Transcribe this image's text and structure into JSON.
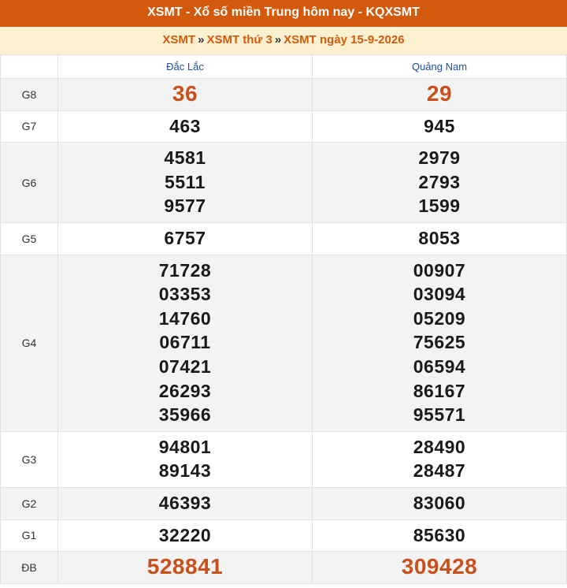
{
  "title": "XSMT - Xổ số miền Trung hôm nay - KQXSMT",
  "breadcrumb": {
    "items": [
      "XSMT",
      "XSMT thứ 3",
      "XSMT ngày 15-9-2026"
    ],
    "separator": "»"
  },
  "table": {
    "provinces": [
      "Đắc Lắc",
      "Quảng Nam"
    ],
    "prizes": [
      {
        "label": "G8",
        "values": [
          [
            "36"
          ],
          [
            "29"
          ]
        ],
        "highlight": true
      },
      {
        "label": "G7",
        "values": [
          [
            "463"
          ],
          [
            "945"
          ]
        ]
      },
      {
        "label": "G6",
        "values": [
          [
            "4581",
            "5511",
            "9577"
          ],
          [
            "2979",
            "2793",
            "1599"
          ]
        ]
      },
      {
        "label": "G5",
        "values": [
          [
            "6757"
          ],
          [
            "8053"
          ]
        ]
      },
      {
        "label": "G4",
        "values": [
          [
            "71728",
            "03353",
            "14760",
            "06711",
            "07421",
            "26293",
            "35966"
          ],
          [
            "00907",
            "03094",
            "05209",
            "75625",
            "06594",
            "86167",
            "95571"
          ]
        ]
      },
      {
        "label": "G3",
        "values": [
          [
            "94801",
            "89143"
          ],
          [
            "28490",
            "28487"
          ]
        ]
      },
      {
        "label": "G2",
        "values": [
          [
            "46393"
          ],
          [
            "83060"
          ]
        ]
      },
      {
        "label": "G1",
        "values": [
          [
            "32220"
          ],
          [
            "85630"
          ]
        ]
      },
      {
        "label": "ĐB",
        "values": [
          [
            "528841"
          ],
          [
            "309428"
          ]
        ],
        "highlight": true
      }
    ]
  },
  "colors": {
    "title_bg": "#d35a0c",
    "breadcrumb_bg": "#fbf1d0",
    "accent": "#d35a0c",
    "highlight_number": "#c8501a",
    "province_header": "#1c4fa0"
  }
}
